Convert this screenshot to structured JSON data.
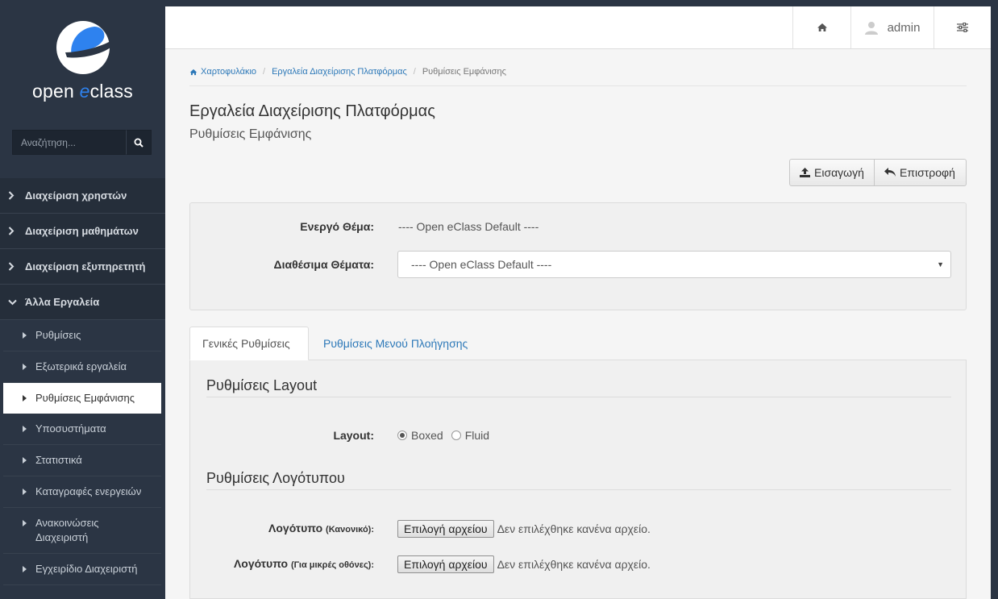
{
  "brand": {
    "name_prefix": "open ",
    "name_accent": "e",
    "name_suffix": "class"
  },
  "search": {
    "placeholder": "Αναζήτηση..."
  },
  "sidebar": {
    "groups": [
      {
        "label": "Διαχείριση χρηστών"
      },
      {
        "label": "Διαχείριση μαθημάτων"
      },
      {
        "label": "Διαχείριση εξυπηρετητή"
      },
      {
        "label": "Άλλα Εργαλεία"
      }
    ],
    "items": [
      {
        "label": "Ρυθμίσεις"
      },
      {
        "label": "Εξωτερικά εργαλεία"
      },
      {
        "label": "Ρυθμίσεις Εμφάνισης"
      },
      {
        "label": "Υποσυστήματα"
      },
      {
        "label": "Στατιστικά"
      },
      {
        "label": "Καταγραφές ενεργειών"
      },
      {
        "label": "Ανακοινώσεις Διαχειριστή"
      },
      {
        "label": "Εγχειρίδιο Διαχειριστή"
      }
    ]
  },
  "topbar": {
    "username": "admin"
  },
  "breadcrumb": {
    "home": "Χαρτοφυλάκιο",
    "tools": "Εργαλεία Διαχείρισης Πλατφόρμας",
    "current": "Ρυθμίσεις Εμφάνισης",
    "separator": "/"
  },
  "page": {
    "title": "Εργαλεία Διαχείρισης Πλατφόρμας",
    "subtitle": "Ρυθμίσεις Εμφάνισης"
  },
  "actions": {
    "import_label": "Εισαγωγή",
    "back_label": "Επιστροφή"
  },
  "theme": {
    "active_label": "Ενεργό Θέμα:",
    "active_value": "---- Open eClass Default ----",
    "available_label": "Διαθέσιμα Θέματα:",
    "selected": "---- Open eClass Default ----"
  },
  "tabs": {
    "general": "Γενικές Ρυθμίσεις",
    "menu": "Ρυθμίσεις Μενού Πλοήγησης"
  },
  "layout_section": {
    "title": "Ρυθμίσεις Layout",
    "label": "Layout:",
    "options": [
      "Boxed",
      "Fluid"
    ],
    "selected": "Boxed"
  },
  "logo_section": {
    "title": "Ρυθμίσεις Λογότυπου",
    "normal_label": "Λογότυπο",
    "normal_hint": "(Κανονικό):",
    "small_label": "Λογότυπο",
    "small_hint": "(Για μικρές οθόνες):",
    "choose_file": "Επιλογή αρχείου",
    "no_file": "Δεν επιλέχθηκε κανένα αρχείο."
  },
  "colors": {
    "accent": "#2c78b8",
    "sidebar_bg": "#2b3544",
    "logo_blue": "#2e82ef"
  }
}
